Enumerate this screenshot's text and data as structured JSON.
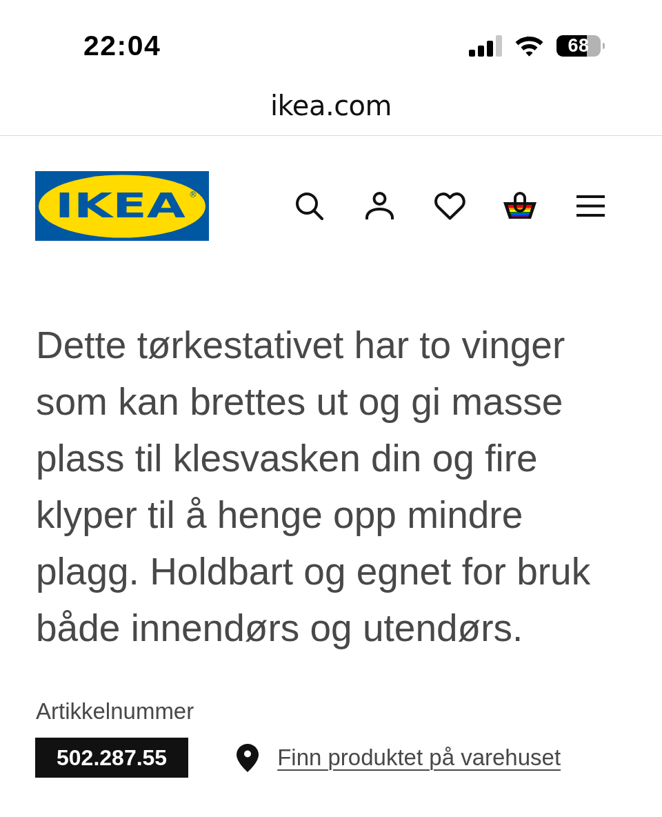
{
  "status_bar": {
    "time": "22:04",
    "battery": "68"
  },
  "address_bar": {
    "url": "ikea.com"
  },
  "header": {
    "logo": {
      "text": "IKEA",
      "mark": "®"
    }
  },
  "description": "Dette tørkestativet har to vinger som kan brettes ut og gi masse plass til klesvasken din og fire klyper til å henge opp mindre plagg. Holdbart og egnet for bruk både innendørs og utendørs.",
  "article": {
    "label": "Artikkelnummer",
    "number": "502.287.55"
  },
  "store_link": "Finn produktet på varehuset"
}
